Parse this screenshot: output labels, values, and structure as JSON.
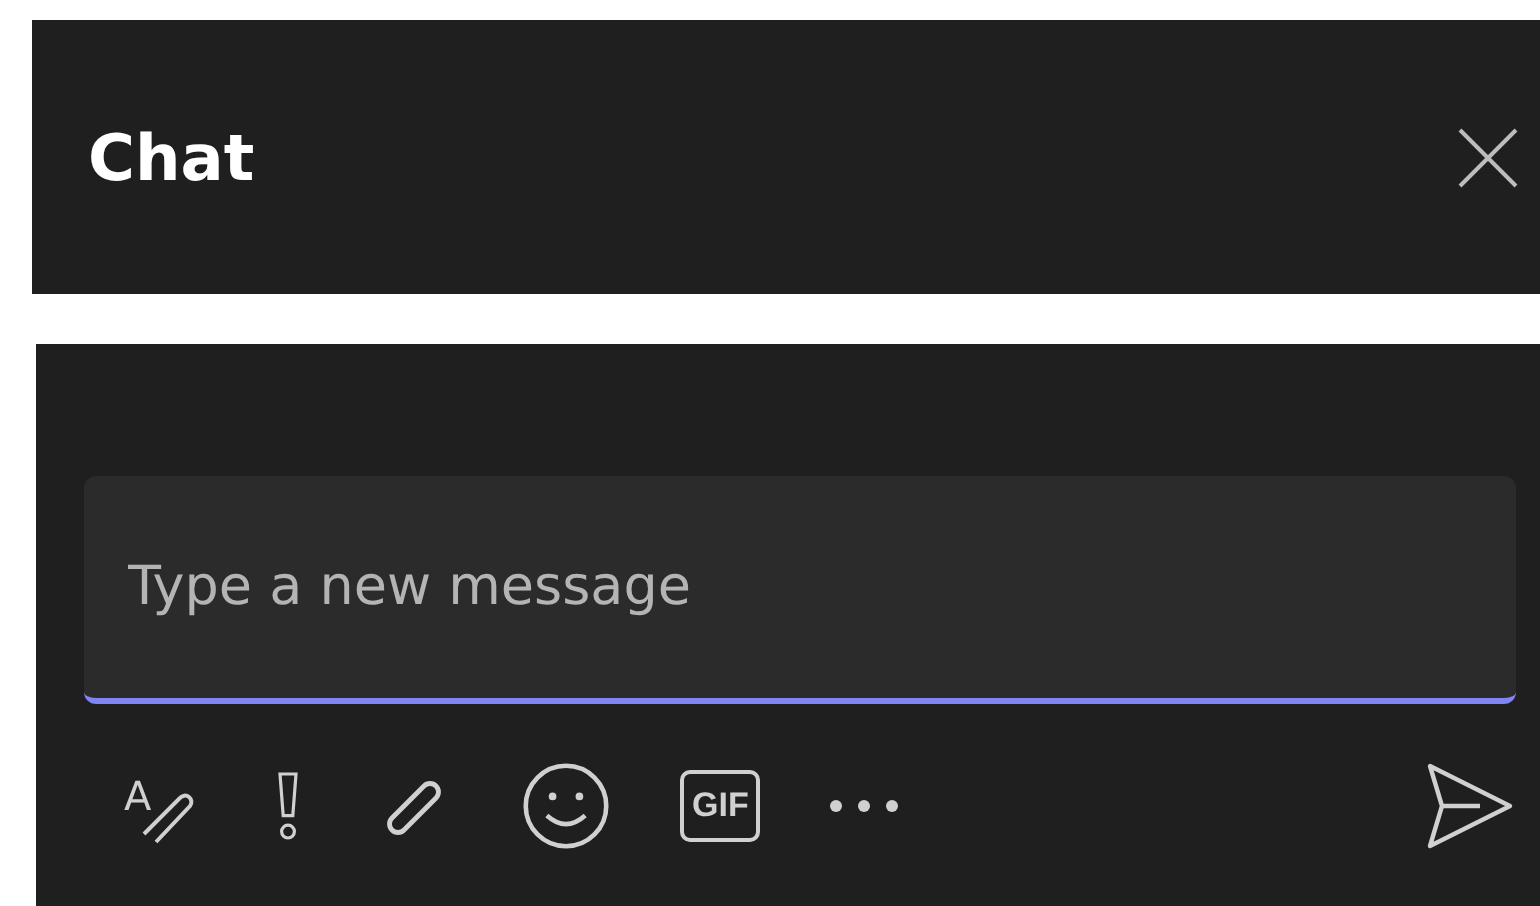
{
  "header": {
    "title": "Chat"
  },
  "composer": {
    "placeholder": "Type a new message"
  },
  "toolbar": [
    {
      "kind": "format",
      "glyph": "A"
    },
    {
      "kind": "important"
    },
    {
      "kind": "attach"
    },
    {
      "kind": "emoji"
    },
    {
      "kind": "gif",
      "glyph": "GIF"
    },
    {
      "kind": "more"
    }
  ]
}
